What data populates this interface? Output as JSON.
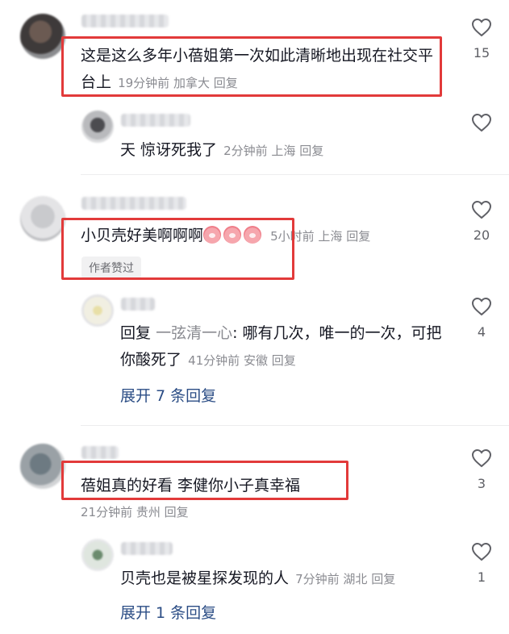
{
  "comments": [
    {
      "text": "这是这么多年小蓓姐第一次如此清晰地出现在社交平台上",
      "time": "19分钟前",
      "location": "加拿大",
      "reply_label": "回复",
      "likes": "15"
    },
    {
      "text": "天 惊讶死我了",
      "time": "2分钟前",
      "location": "上海",
      "reply_label": "回复"
    },
    {
      "text": "小贝壳好美啊啊啊",
      "emoji": "pig-face-emoji",
      "time": "5小时前",
      "location": "上海",
      "reply_label": "回复",
      "likes": "20",
      "tag": "作者赞过"
    },
    {
      "prefix": "回复",
      "mention": "一弦清一心",
      "text": ": 哪有几次，唯一的一次，可把你酸死了",
      "time": "41分钟前",
      "location": "安徽",
      "reply_label": "回复",
      "likes": "4"
    },
    {
      "text": "蓓姐真的好看 李健你小子真幸福",
      "time": "21分钟前",
      "location": "贵州",
      "reply_label": "回复",
      "likes": "3"
    },
    {
      "text": "贝壳也是被星探发现的人",
      "time": "7分钟前",
      "location": "湖北",
      "reply_label": "回复",
      "likes": "1"
    }
  ],
  "expand_1": "展开 7 条回复",
  "expand_2": "展开 1 条回复",
  "colors": {
    "highlight_box": "#e23a3a",
    "link": "#2b4d85",
    "meta": "#8a8b91"
  },
  "icons": [
    "heart-outline-icon"
  ]
}
